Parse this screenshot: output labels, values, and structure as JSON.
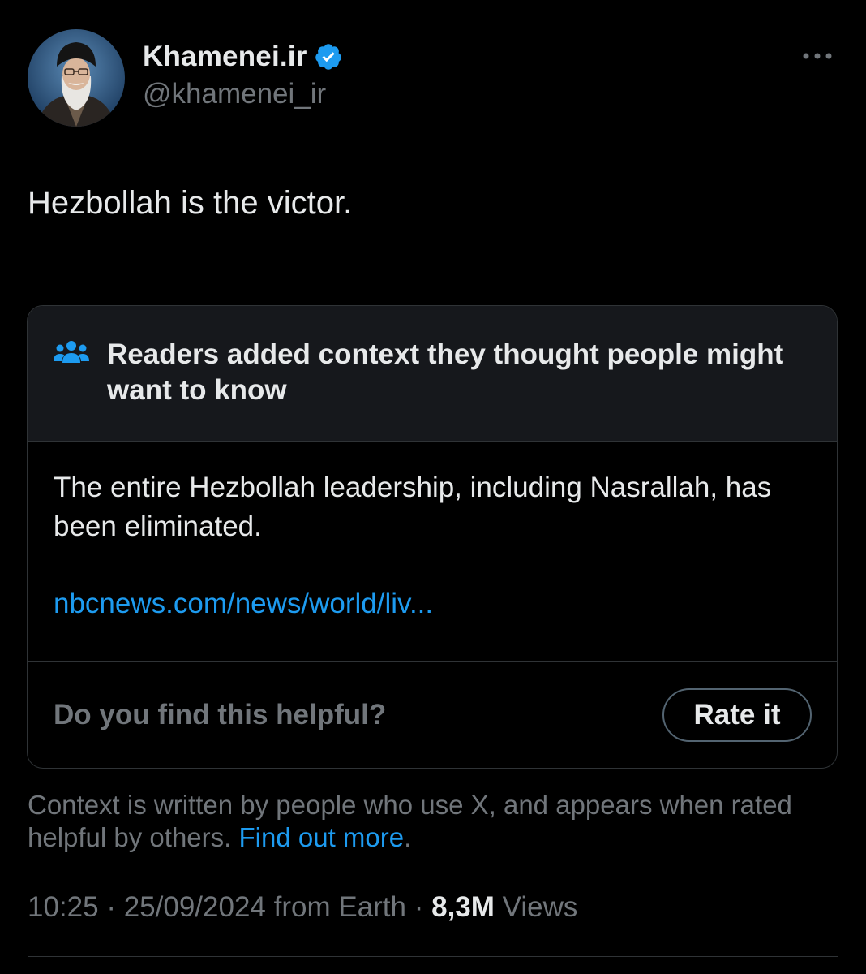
{
  "author": {
    "display_name": "Khamenei.ir",
    "handle": "@khamenei_ir",
    "verified": true,
    "verified_color": "#1d9bf0"
  },
  "tweet": {
    "text": "Hezbollah is the victor."
  },
  "community_note": {
    "header": "Readers added context they thought people might want to know",
    "body": "The entire Hezbollah leadership, including Nasrallah, has been eliminated.",
    "link": "nbcnews.com/news/world/liv...",
    "helpful_question": "Do you find this helpful?",
    "rate_button": "Rate it",
    "icon_color": "#1d9bf0"
  },
  "context_info": {
    "text": "Context is written by people who use X, and appears when rated helpful by others.",
    "link": "Find out more",
    "suffix": "."
  },
  "meta": {
    "time": "10:25",
    "date": "25/09/2024",
    "source": "from Earth",
    "views_count": "8,3M",
    "views_label": "Views"
  },
  "colors": {
    "background": "#000000",
    "text_primary": "#e7e9ea",
    "text_secondary": "#71767b",
    "link": "#1d9bf0",
    "border": "#2f3336",
    "note_header_bg": "#16181c"
  },
  "icons": [
    "verified-badge-icon",
    "more-options-icon",
    "people-group-icon"
  ]
}
